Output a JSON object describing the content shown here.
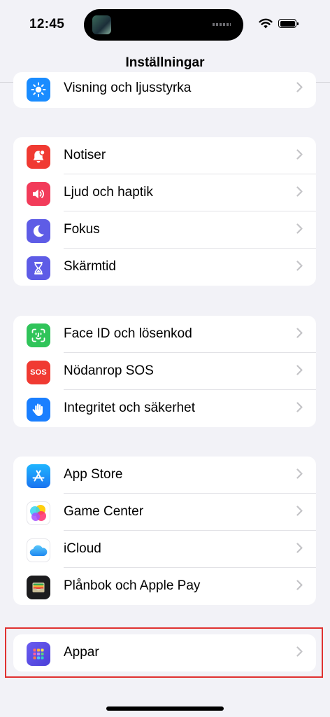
{
  "status_bar": {
    "time": "12:45"
  },
  "nav": {
    "title": "Inställningar"
  },
  "group0": [
    {
      "label": "Visning och ljusstyrka",
      "icon": "sun-icon",
      "color": "#1a8cff"
    }
  ],
  "group1": [
    {
      "label": "Notiser",
      "icon": "bell-icon",
      "color": "#f03a32"
    },
    {
      "label": "Ljud och haptik",
      "icon": "speaker-icon",
      "color": "#f23b5a"
    },
    {
      "label": "Fokus",
      "icon": "moon-icon",
      "color": "#5e5ce6"
    },
    {
      "label": "Skärmtid",
      "icon": "hourglass-icon",
      "color": "#5e5ce6"
    }
  ],
  "group2": [
    {
      "label": "Face ID och lösenkod",
      "icon": "face-id-icon",
      "color": "#30c45a"
    },
    {
      "label": "Nödanrop SOS",
      "icon": "sos-icon",
      "icon_text": "SOS",
      "color": "#f03a32"
    },
    {
      "label": "Integritet och säkerhet",
      "icon": "hand-icon",
      "color": "#1a7fff"
    }
  ],
  "group3": [
    {
      "label": "App Store",
      "icon": "app-store-icon",
      "color": "#1f8fff"
    },
    {
      "label": "Game Center",
      "icon": "game-center-icon",
      "color": "#ffffff"
    },
    {
      "label": "iCloud",
      "icon": "icloud-icon",
      "color": "#ffffff"
    },
    {
      "label": "Plånbok och Apple Pay",
      "icon": "wallet-icon",
      "color": "#1c1c1e"
    }
  ],
  "group4": [
    {
      "label": "Appar",
      "icon": "apps-grid-icon",
      "color": "#5b4ee8"
    }
  ],
  "annotation": {
    "color": "#e03130"
  }
}
